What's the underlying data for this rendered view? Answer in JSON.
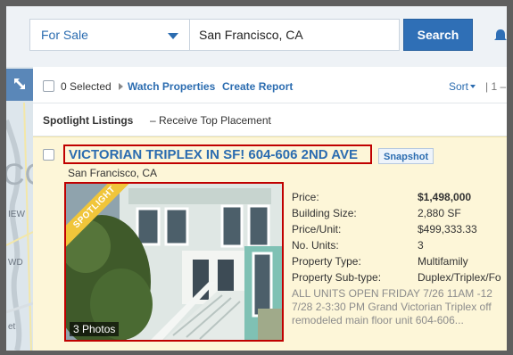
{
  "search": {
    "type_select": "For Sale",
    "location_value": "San Francisco, CA",
    "search_label": "Search"
  },
  "map": {
    "labels": [
      "IEW",
      "WD",
      "et"
    ],
    "big_letters": "CC"
  },
  "toolbar": {
    "selected_label": "0 Selected",
    "watch_label": "Watch Properties",
    "report_label": "Create Report",
    "sort_label": "Sort",
    "pagination": "| 1 –"
  },
  "spotlight": {
    "title": "Spotlight Listings",
    "subtitle": "– Receive Top Placement"
  },
  "listing": {
    "title": "VICTORIAN TRIPLEX IN SF! 604-606 2ND AVE",
    "snapshot_label": "Snapshot",
    "location": "San Francisco, CA",
    "ribbon": "SPOTLIGHT",
    "photos_label": "3 Photos",
    "facts": [
      {
        "label": "Price:",
        "value": "$1,498,000"
      },
      {
        "label": "Building Size:",
        "value": "2,880 SF"
      },
      {
        "label": "Price/Unit:",
        "value": "$499,333.33"
      },
      {
        "label": "No. Units:",
        "value": "3"
      },
      {
        "label": "Property Type:",
        "value": "Multifamily"
      },
      {
        "label": "Property Sub-type:",
        "value": "Duplex/Triplex/Fo"
      }
    ],
    "description_lines": [
      "ALL UNITS OPEN FRIDAY 7/26 11AM -12",
      "7/28 2-3:30 PM Grand Victorian Triplex off",
      "remodeled main floor unit 604-606..."
    ]
  },
  "colors": {
    "accent": "#2f6fb6",
    "link": "#2b6cb0",
    "highlight_border": "#c00000",
    "card_background": "#fdf6d8",
    "ribbon": "#f0c53a"
  }
}
